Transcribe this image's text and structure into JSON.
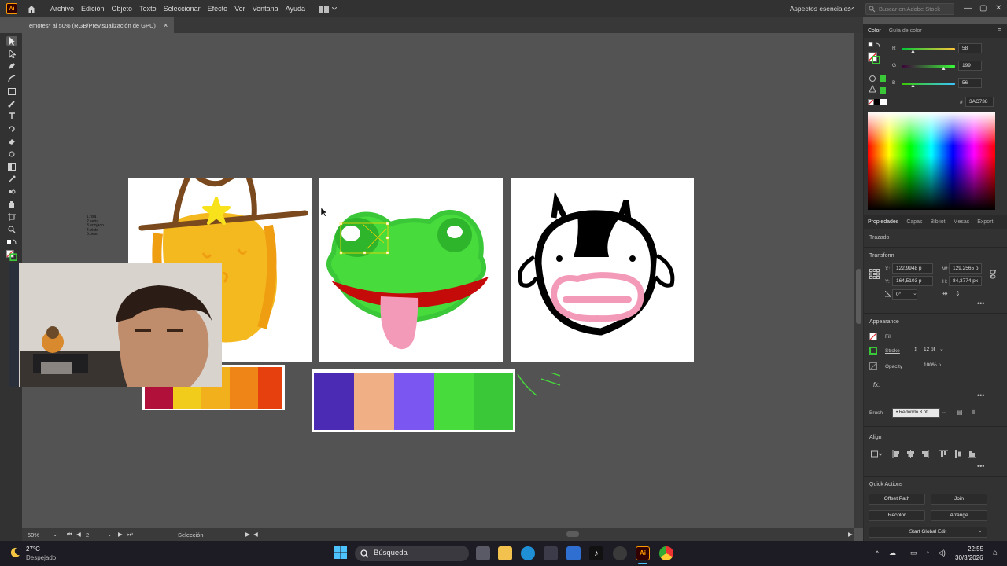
{
  "app": {
    "logo": "Ai",
    "menu": [
      "Archivo",
      "Edición",
      "Objeto",
      "Texto",
      "Seleccionar",
      "Efecto",
      "Ver",
      "Ventana",
      "Ayuda"
    ],
    "workspace": "Aspectos esenciales",
    "stock_search_placeholder": "Buscar en Adobe Stock"
  },
  "document_tab": {
    "title": "emotes* al 50% (RGB/Previsualización de GPU)",
    "close": "×"
  },
  "artboard_notes": [
    "1.risa",
    "2.seria",
    "3.enojado",
    "4.triste",
    "5.beso"
  ],
  "status_bar": {
    "zoom": "50%",
    "artboard_number": "2",
    "tool": "Selección"
  },
  "color_panel": {
    "tabs": [
      "Color",
      "Guía de color"
    ],
    "r_label": "R",
    "r_value": "58",
    "g_label": "G",
    "g_value": "199",
    "b_label": "B",
    "b_value": "56",
    "hex_label": "#",
    "hex_value": "3AC738",
    "accent": "#3AC738"
  },
  "properties_panel": {
    "tabs": [
      "Propiedades",
      "Capas",
      "Bibliot",
      "Mesas",
      "Export"
    ],
    "object_type": "Trazado",
    "transform_title": "Transform",
    "x_label": "X:",
    "x_value": "122,9948 p",
    "y_label": "Y:",
    "y_value": "164,5103 p",
    "w_label": "W:",
    "w_value": "129,2565 p",
    "h_label": "H:",
    "h_value": "84,3774 px",
    "rotation": "0°",
    "appearance_title": "Appearance",
    "fill_label": "Fill",
    "stroke_label": "Stroke",
    "stroke_value": "12 pt",
    "opacity_label": "Opacity",
    "opacity_value": "100%",
    "fx": "fx.",
    "brush_label": "Brush",
    "brush_value": "Redondo 3 pt.",
    "align_title": "Align",
    "quick_actions_title": "Quick Actions",
    "quick_actions": [
      "Offset Path",
      "Join",
      "Recolor",
      "Arrange"
    ],
    "global_edit": "Start Global Edit"
  },
  "palettes": {
    "warm": [
      "#B0103A",
      "#F2CC1A",
      "#F1B01C",
      "#EF8517",
      "#E5400E"
    ],
    "cool": [
      "#4B2BB3",
      "#F1AF86",
      "#7C56F0",
      "#47DB3C",
      "#3AC738"
    ]
  },
  "taskbar": {
    "weather_temp": "27°C",
    "weather_desc": "Despejado",
    "search_placeholder": "Búsqueda",
    "time": "22:55",
    "date": "30/3/2026"
  }
}
